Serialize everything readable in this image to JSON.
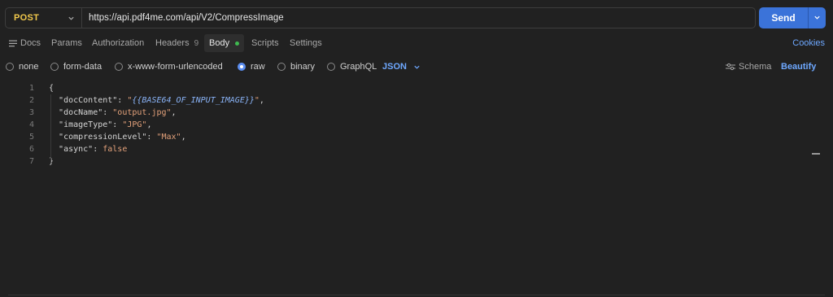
{
  "request": {
    "method": "POST",
    "url": "https://api.pdf4me.com/api/V2/CompressImage",
    "send_label": "Send"
  },
  "tabs": [
    {
      "label": "Docs"
    },
    {
      "label": "Params"
    },
    {
      "label": "Authorization"
    },
    {
      "label": "Headers",
      "count": "9"
    },
    {
      "label": "Body",
      "active": true
    },
    {
      "label": "Scripts"
    },
    {
      "label": "Settings"
    }
  ],
  "cookies_label": "Cookies",
  "body_types": [
    {
      "label": "none"
    },
    {
      "label": "form-data"
    },
    {
      "label": "x-www-form-urlencoded"
    },
    {
      "label": "raw",
      "selected": true
    },
    {
      "label": "binary"
    },
    {
      "label": "GraphQL"
    }
  ],
  "format_select": "JSON",
  "schema_label": "Schema",
  "beautify_label": "Beautify",
  "editor": {
    "line_numbers": [
      "1",
      "2",
      "3",
      "4",
      "5",
      "6",
      "7"
    ],
    "open_brace": "{",
    "close_brace": "}",
    "fields": [
      {
        "key": "\"docContent\"",
        "value": "{{BASE64_OF_INPUT_IMAGE}}"
      },
      {
        "key": "\"docName\"",
        "value": "\"output.jpg\""
      },
      {
        "key": "\"imageType\"",
        "value": "\"JPG\""
      },
      {
        "key": "\"compressionLevel\"",
        "value": "\"Max\""
      },
      {
        "key": "\"async\"",
        "value": "false"
      }
    ]
  },
  "colors": {
    "accent": "#3b73d9",
    "method": "#f2c94c",
    "link": "#6ea8ff",
    "string": "#e3a17a",
    "variable": "#8ab4f8",
    "active_dot": "#3fb950"
  }
}
